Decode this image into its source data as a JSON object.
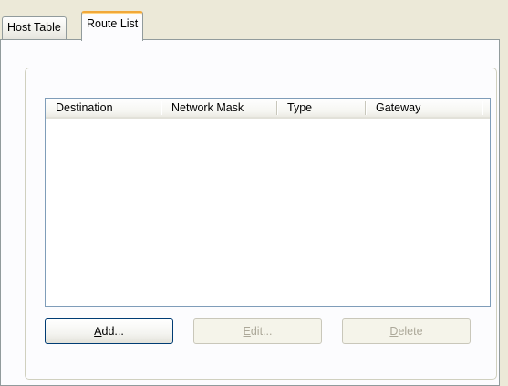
{
  "tabs": [
    {
      "label": "Host Table",
      "active": false
    },
    {
      "label": "Route List",
      "active": true
    }
  ],
  "route_list": {
    "columns": [
      "Destination",
      "Network Mask",
      "Type",
      "Gateway"
    ],
    "rows": []
  },
  "buttons": {
    "add": {
      "mnemonic": "A",
      "rest": "dd...",
      "enabled": true
    },
    "edit": {
      "mnemonic": "E",
      "rest": "dit...",
      "enabled": false
    },
    "delete": {
      "mnemonic": "D",
      "rest": "elete",
      "enabled": false
    }
  },
  "colors": {
    "window_bg": "#ece9d8",
    "panel_bg": "#fcfcfe",
    "active_tab_accent": "#f1a83a",
    "default_button_border": "#003c74",
    "disabled_text": "#aca899",
    "listview_border": "#7f9db9"
  }
}
